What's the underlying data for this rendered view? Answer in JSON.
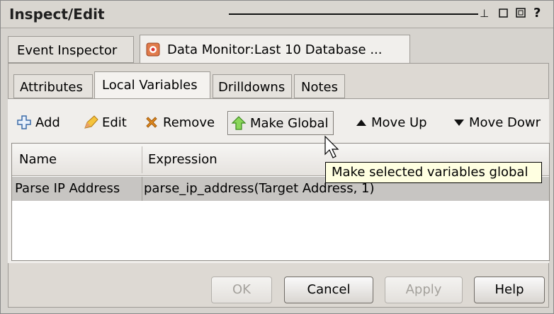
{
  "window": {
    "title": "Inspect/Edit"
  },
  "title_buttons": {
    "minimize": "⊥",
    "restore": "□",
    "maximize": "◫",
    "help": "?"
  },
  "outer_tabs": [
    {
      "label": "Event Inspector"
    },
    {
      "label": "Data Monitor:Last 10 Database ...",
      "icon": "data-monitor-icon"
    }
  ],
  "inner_tabs": [
    {
      "label": "Attributes"
    },
    {
      "label": "Local Variables"
    },
    {
      "label": "Drilldowns"
    },
    {
      "label": "Notes"
    }
  ],
  "toolbar": {
    "add": "Add",
    "edit": "Edit",
    "remove": "Remove",
    "make_global": "Make Global",
    "move_up": "Move Up",
    "move_down": "Move Dowr"
  },
  "table": {
    "columns": [
      "Name",
      "Expression"
    ],
    "rows": [
      {
        "name": "Parse IP Address",
        "expression": "parse_ip_address(Target Address, 1)"
      }
    ]
  },
  "tooltip": "Make selected variables global",
  "buttons": {
    "ok": "OK",
    "cancel": "Cancel",
    "apply": "Apply",
    "help": "Help"
  },
  "colors": {
    "selected_row": "#c7c5c2",
    "tooltip_bg": "#ffffe1",
    "make_global_arrow": "#7fcf4f",
    "remove_x": "#e08a1e"
  }
}
